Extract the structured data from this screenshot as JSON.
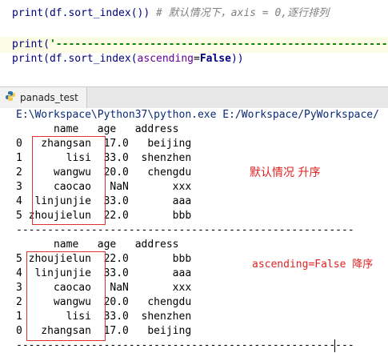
{
  "editor": {
    "line1_code": "print(df.sort_index())",
    "line1_comment": "# 默认情况下，axis = 0,逐行排列",
    "line2_prefix": "print(",
    "line2_string": "'------------------------------------------------------'",
    "line2_suffix": ")",
    "line3_prefix": "print(df.sort_index(",
    "line3_param": "ascending",
    "line3_eq": "=",
    "line3_value": "False",
    "line3_suffix": "))"
  },
  "run_tab": {
    "label": "panads_test",
    "icon": "python-icon"
  },
  "console": {
    "command_line": "E:\\Workspace\\Python37\\python.exe E:/Workspace/PyWorkspace/",
    "table1": {
      "header": "      name   age   address",
      "rows": [
        "0   zhangsan  17.0   beijing",
        "1       lisi  33.0  shenzhen",
        "2     wangwu  20.0   chengdu",
        "3     caocao   NaN       xxx",
        "4  linjunjie  33.0       aaa",
        "5 zhoujielun  22.0       bbb"
      ]
    },
    "separator": "------------------------------------------------------",
    "table2": {
      "header": "      name   age   address",
      "rows": [
        "5 zhoujielun  22.0       bbb",
        "4  linjunjie  33.0       aaa",
        "3     caocao   NaN       xxx",
        "2     wangwu  20.0   chengdu",
        "1       lisi  33.0  shenzhen",
        "0   zhangsan  17.0   beijing"
      ]
    },
    "separator_bottom": "------------------------------------------------------"
  },
  "annotations": {
    "note1": "默认情况  升序",
    "note2": "ascending=False 降序",
    "color": "#e02020"
  }
}
